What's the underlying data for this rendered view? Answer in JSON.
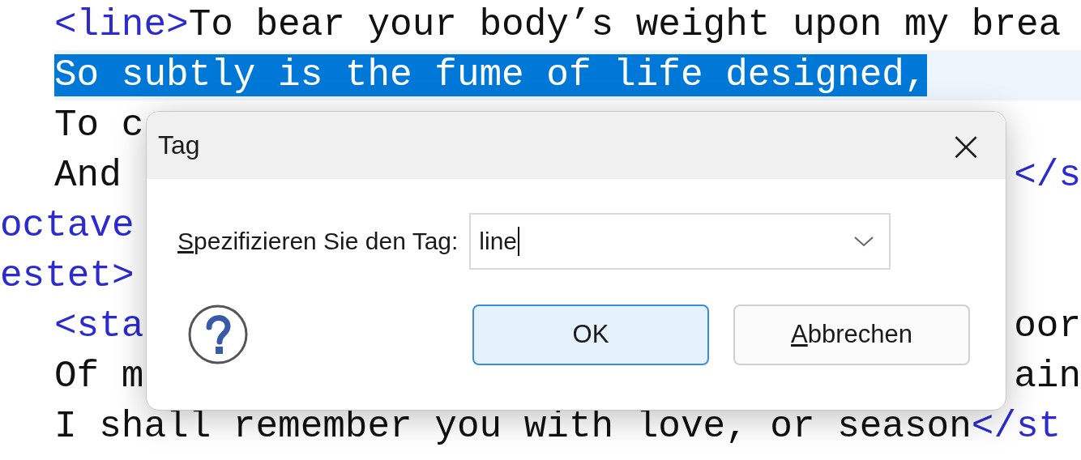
{
  "editor": {
    "lines": [
      {
        "children": [
          {
            "segments": [
              {
                "kind": "tag",
                "text": "<line>"
              },
              {
                "kind": "text",
                "text": "To bear your body’s weight upon my brea"
              }
            ],
            "selected": false
          },
          {
            "segments": [
              {
                "kind": "text",
                "text": "So subtly is the fume of life designed,"
              }
            ],
            "selected": true
          },
          {
            "segments": [
              {
                "kind": "text",
                "text": "To c"
              }
            ],
            "selected": false
          },
          {
            "segments": [
              {
                "kind": "text",
                "text": "And"
              }
            ],
            "right": [
              {
                "kind": "tag",
                "text": "</s"
              }
            ],
            "selected": false
          }
        ]
      },
      {
        "segments": [
          {
            "kind": "tag",
            "text": "octave"
          }
        ],
        "selected": false
      },
      {
        "segments": [
          {
            "kind": "tag",
            "text": "estet>"
          }
        ],
        "selected": false,
        "children": [
          {
            "segments": [
              {
                "kind": "tag",
                "text": "<sta"
              }
            ],
            "right": [
              {
                "kind": "text",
                "text": "oor"
              }
            ],
            "selected": false
          },
          {
            "segments": [
              {
                "kind": "text",
                "text": "Of m"
              }
            ],
            "right": [
              {
                "kind": "text",
                "text": "ain"
              }
            ],
            "selected": false
          },
          {
            "segments": [
              {
                "kind": "text",
                "text": "I shall remember you with love, or season"
              },
              {
                "kind": "tag",
                "text": "</st"
              }
            ],
            "selected": false
          }
        ]
      }
    ]
  },
  "dialog": {
    "title": "Tag",
    "close": "×",
    "label": "Spezifizieren Sie den Tag:",
    "label_underlined_first": true,
    "value": "line",
    "buttons": [
      {
        "label": "OK",
        "default": true,
        "underlined_first": false
      },
      {
        "label": "Abbrechen",
        "default": false,
        "underlined_first": true
      }
    ]
  }
}
